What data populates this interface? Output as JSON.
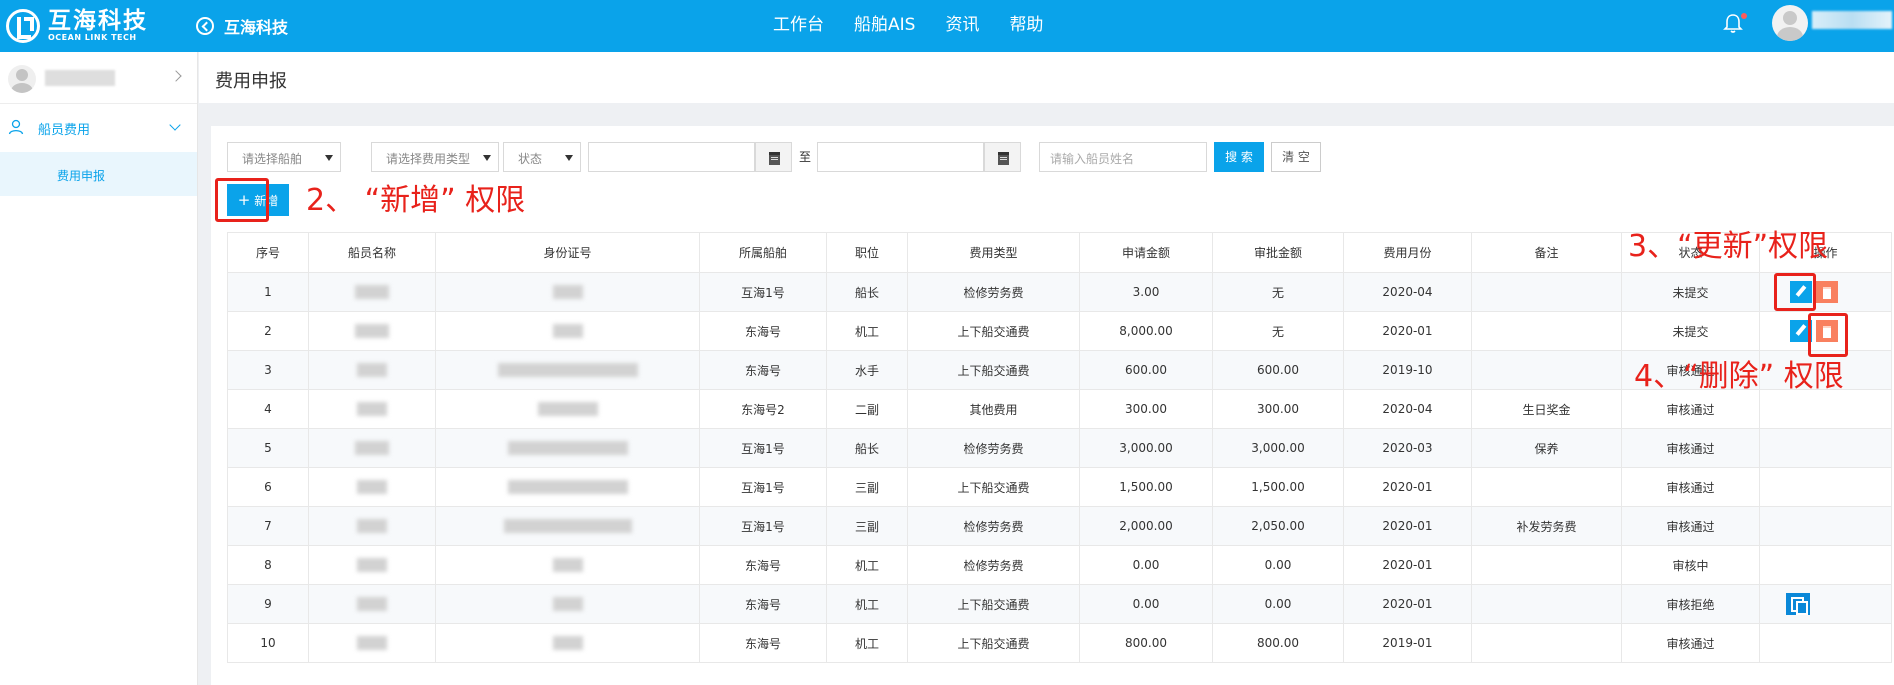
{
  "topbar": {
    "logo_cn": "互海科技",
    "logo_en": "OCEAN LINK TECH",
    "back_label": "互海科技",
    "nav": [
      "工作台",
      "船舶AIS",
      "资讯",
      "帮助"
    ]
  },
  "sidebar": {
    "menu_label": "船员费用",
    "sub_label": "费用申报"
  },
  "page": {
    "title": "费用申报"
  },
  "filters": {
    "ship_select": "请选择船舶",
    "fee_type_select": "请选择费用类型",
    "status_select": "状态",
    "date_separator": "至",
    "name_placeholder": "请输入船员姓名",
    "search_label": "搜 索",
    "clear_label": "清 空"
  },
  "toolbar": {
    "add_label": "新增"
  },
  "table": {
    "headers": [
      "序号",
      "船员名称",
      "身份证号",
      "所属船舶",
      "职位",
      "费用类型",
      "申请金额",
      "审批金额",
      "费用月份",
      "备注",
      "状态",
      "操作"
    ],
    "rows": [
      {
        "no": "1",
        "ship": "互海1号",
        "position": "船长",
        "fee_type": "检修劳务费",
        "apply": "3.00",
        "approve": "无",
        "month": "2020-04",
        "remark": "",
        "status": "未提交"
      },
      {
        "no": "2",
        "ship": "东海号",
        "position": "机工",
        "fee_type": "上下船交通费",
        "apply": "8,000.00",
        "approve": "无",
        "month": "2020-01",
        "remark": "",
        "status": "未提交"
      },
      {
        "no": "3",
        "ship": "东海号",
        "position": "水手",
        "fee_type": "上下船交通费",
        "apply": "600.00",
        "approve": "600.00",
        "month": "2019-10",
        "remark": "",
        "status": "审核通过"
      },
      {
        "no": "4",
        "ship": "东海号2",
        "position": "二副",
        "fee_type": "其他费用",
        "apply": "300.00",
        "approve": "300.00",
        "month": "2020-04",
        "remark": "生日奖金",
        "status": "审核通过"
      },
      {
        "no": "5",
        "ship": "互海1号",
        "position": "船长",
        "fee_type": "检修劳务费",
        "apply": "3,000.00",
        "approve": "3,000.00",
        "month": "2020-03",
        "remark": "保养",
        "status": "审核通过"
      },
      {
        "no": "6",
        "ship": "互海1号",
        "position": "三副",
        "fee_type": "上下船交通费",
        "apply": "1,500.00",
        "approve": "1,500.00",
        "month": "2020-01",
        "remark": "",
        "status": "审核通过"
      },
      {
        "no": "7",
        "ship": "互海1号",
        "position": "三副",
        "fee_type": "检修劳务费",
        "apply": "2,000.00",
        "approve": "2,050.00",
        "month": "2020-01",
        "remark": "补发劳务费",
        "status": "审核通过"
      },
      {
        "no": "8",
        "ship": "东海号",
        "position": "机工",
        "fee_type": "检修劳务费",
        "apply": "0.00",
        "approve": "0.00",
        "month": "2020-01",
        "remark": "",
        "status": "审核中"
      },
      {
        "no": "9",
        "ship": "东海号",
        "position": "机工",
        "fee_type": "上下船交通费",
        "apply": "0.00",
        "approve": "0.00",
        "month": "2020-01",
        "remark": "",
        "status": "审核拒绝"
      },
      {
        "no": "10",
        "ship": "东海号",
        "position": "机工",
        "fee_type": "上下船交通费",
        "apply": "800.00",
        "approve": "800.00",
        "month": "2019-01",
        "remark": "",
        "status": "审核通过"
      }
    ]
  },
  "annotations": {
    "add": "2、 “新增” 权限",
    "update": "3、“更新”权限",
    "delete": "4、“删除” 权限"
  },
  "colors": {
    "brand": "#0aa3ea",
    "annotation": "#e8221b",
    "delete_button": "#f9805f"
  }
}
